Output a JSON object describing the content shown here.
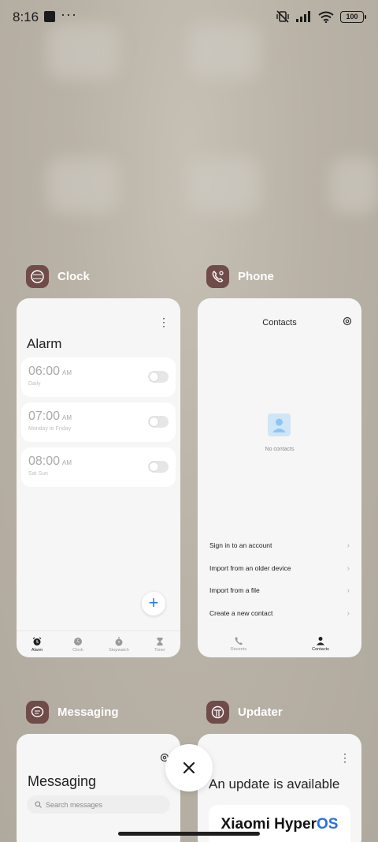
{
  "status_bar": {
    "time": "8:16",
    "overflow": "···",
    "battery": "100"
  },
  "apps": {
    "clock": {
      "name": "Clock",
      "screen_title": "Alarm",
      "alarms": [
        {
          "time": "06:00",
          "ampm": "AM",
          "repeat": "Daily"
        },
        {
          "time": "07:00",
          "ampm": "AM",
          "repeat": "Monday to Friday"
        },
        {
          "time": "08:00",
          "ampm": "AM",
          "repeat": "Sat Sun"
        }
      ],
      "fab": "+",
      "tabs": [
        "Alarm",
        "Clock",
        "Stopwatch",
        "Timer"
      ]
    },
    "phone": {
      "name": "Phone",
      "screen_title": "Contacts",
      "empty_text": "No contacts",
      "actions": [
        "Sign in to an account",
        "Import from an older device",
        "Import from a file",
        "Create a new contact"
      ],
      "tabs": [
        "Recents",
        "Contacts"
      ]
    },
    "messaging": {
      "name": "Messaging",
      "screen_title": "Messaging",
      "search_placeholder": "Search messages"
    },
    "updater": {
      "name": "Updater",
      "screen_title": "An update is available",
      "brand_main": "Xiaomi Hyper",
      "brand_accent": "OS"
    }
  },
  "colors": {
    "app_icon": "#6f4c4a",
    "accent_blue": "#2a7de1",
    "brand_blue": "#2a6fe0"
  }
}
